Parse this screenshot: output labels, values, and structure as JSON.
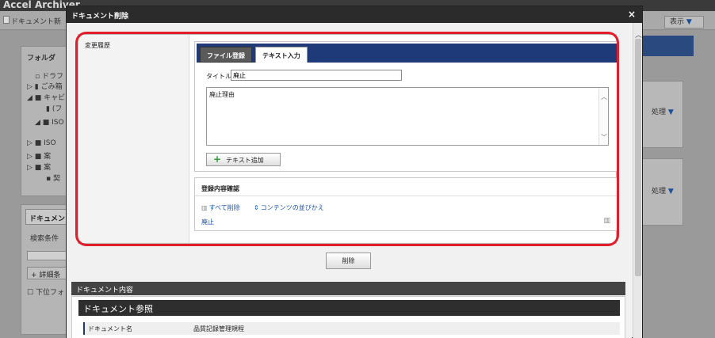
{
  "background": {
    "app_title": "Accel Archiver",
    "doc_new": "ドキュメント新",
    "display_label": "表示",
    "folder_label": "フォルダ",
    "tree_items": [
      "ドラフ",
      "ごみ箱",
      "キャビ",
      "(フ",
      "ISO",
      "ISO",
      "案",
      "案",
      "契"
    ],
    "doc_tab": "ドキュメン",
    "search_label": "検索条件",
    "detail_button": "詳細条",
    "lower_check": "下位フォ",
    "process_label": "処理"
  },
  "modal": {
    "title": "ドキュメント削除",
    "close": "×",
    "history_label": "変更履歴",
    "tabs": [
      {
        "label": "ファイル登録"
      },
      {
        "label": "テキスト入力"
      }
    ],
    "title_field_label": "タイトル",
    "title_field_value": "廃止",
    "text_area_value": "廃止理由",
    "add_text_button": "テキスト追加",
    "confirm_title": "登録内容確認",
    "delete_all": "すべて削除",
    "sort_contents": "コンテンツの並びかえ",
    "entry_title": "廃止",
    "delete_button": "削除",
    "doc_contents_section": "ドキュメント内容",
    "doc_reference_title": "ドキュメント参照",
    "doc_name_label": "ドキュメント名",
    "doc_name_value": "品質記録管理規程"
  },
  "colors": {
    "accent": "#1e3a78",
    "highlight": "#e41d2b",
    "link": "#1a55b0",
    "plus": "#2fa030"
  }
}
